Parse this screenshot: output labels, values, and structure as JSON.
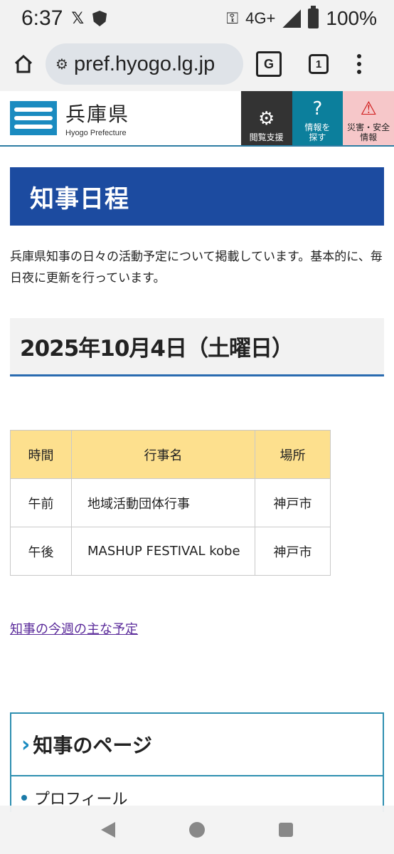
{
  "status": {
    "time": "6:37",
    "network": "4G+",
    "battery": "100%"
  },
  "browser": {
    "url": "pref.hyogo.lg.jp",
    "tab_count": "1"
  },
  "site": {
    "name": "兵庫県",
    "name_en": "Hyogo Prefecture",
    "buttons": [
      {
        "label": "閲覧支援",
        "icon": "globe-gear-icon"
      },
      {
        "label": "情報を探す",
        "icon": "search-info-icon"
      },
      {
        "label": "災害・安全情報",
        "icon": "warning-icon"
      }
    ]
  },
  "page": {
    "title": "知事日程",
    "intro": "兵庫県知事の日々の活動予定について掲載しています。基本的に、毎日夜に更新を行っています。",
    "date_heading": "2025年10月4日（土曜日）",
    "table": {
      "headers": [
        "時間",
        "行事名",
        "場所"
      ],
      "rows": [
        [
          "午前",
          "地域活動団体行事",
          "神戸市"
        ],
        [
          "午後",
          "MASHUP FESTIVAL kobe",
          "神戸市"
        ]
      ]
    },
    "week_link": "知事の今週の主な予定",
    "governor_box": {
      "title": "知事のページ",
      "items": [
        "プロフィール"
      ]
    }
  },
  "colors": {
    "title_bg": "#1c4ba0",
    "table_header_bg": "#fde08e",
    "accent": "#1a8bc0"
  }
}
